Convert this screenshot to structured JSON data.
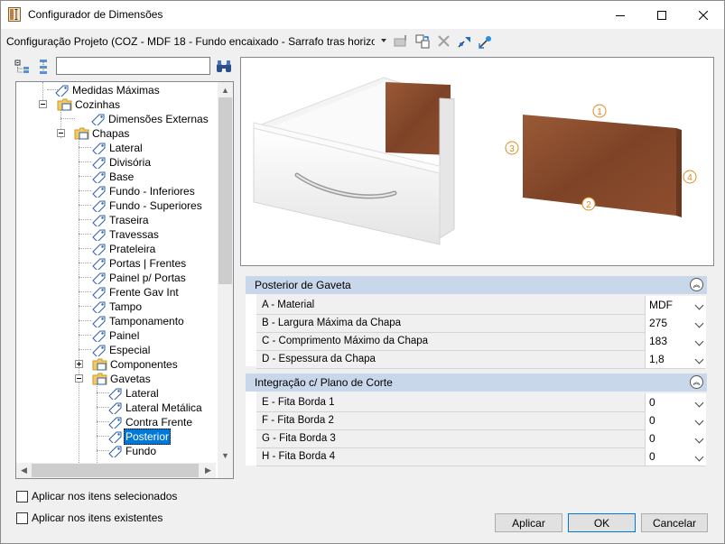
{
  "window": {
    "title": "Configurador de Dimensões",
    "minimize_icon": "minimize-icon",
    "maximize_icon": "maximize-icon",
    "close_icon": "close-icon"
  },
  "toolbar": {
    "config_selected": "Configuração Projeto (COZ - MDF 18 - Fundo encaixado - Sarrafo tras horizo",
    "icons": [
      "edit-config-icon",
      "copy-config-icon",
      "delete-icon",
      "export-icon",
      "import-icon"
    ]
  },
  "tree_toolbar": {
    "search_value": "",
    "search_placeholder": ""
  },
  "tree": {
    "nodes": [
      {
        "label": "Medidas Máximas",
        "icon": "tag-icon"
      },
      {
        "label": "Cozinhas",
        "icon": "folder-icon"
      },
      {
        "label": "Dimensões Externas",
        "icon": "tag-icon"
      },
      {
        "label": "Chapas",
        "icon": "folder-icon"
      },
      {
        "label": "Lateral",
        "icon": "tag-icon"
      },
      {
        "label": "Divisória",
        "icon": "tag-icon"
      },
      {
        "label": "Base",
        "icon": "tag-icon"
      },
      {
        "label": "Fundo - Inferiores",
        "icon": "tag-icon"
      },
      {
        "label": "Fundo - Superiores",
        "icon": "tag-icon"
      },
      {
        "label": "Traseira",
        "icon": "tag-icon"
      },
      {
        "label": "Travessas",
        "icon": "tag-icon"
      },
      {
        "label": "Prateleira",
        "icon": "tag-icon"
      },
      {
        "label": "Portas | Frentes",
        "icon": "tag-icon"
      },
      {
        "label": "Painel p/ Portas",
        "icon": "tag-icon"
      },
      {
        "label": "Frente Gav Int",
        "icon": "tag-icon"
      },
      {
        "label": "Tampo",
        "icon": "tag-icon"
      },
      {
        "label": "Tamponamento",
        "icon": "tag-icon"
      },
      {
        "label": "Painel",
        "icon": "tag-icon"
      },
      {
        "label": "Especial",
        "icon": "tag-icon"
      },
      {
        "label": "Componentes",
        "icon": "folder-icon"
      },
      {
        "label": "Gavetas",
        "icon": "folder-icon"
      },
      {
        "label": "Lateral",
        "icon": "tag-icon"
      },
      {
        "label": "Lateral Metálica",
        "icon": "tag-icon"
      },
      {
        "label": "Contra Frente",
        "icon": "tag-icon"
      },
      {
        "label": "Posterior",
        "icon": "tag-icon",
        "selected": true
      },
      {
        "label": "Fundo",
        "icon": "tag-icon"
      }
    ]
  },
  "preview": {
    "markers": [
      "1",
      "2",
      "3",
      "4"
    ]
  },
  "sections": [
    {
      "title": "Posterior de Gaveta",
      "rows": [
        {
          "label": "A - Material",
          "value": "MDF"
        },
        {
          "label": "B - Largura Máxima da Chapa",
          "value": "275"
        },
        {
          "label": "C - Comprimento Máximo da Chapa",
          "value": "183"
        },
        {
          "label": "D - Espessura da Chapa",
          "value": "1,8"
        }
      ]
    },
    {
      "title": "Integração c/ Plano de Corte",
      "rows": [
        {
          "label": "E - Fita Borda 1",
          "value": "0"
        },
        {
          "label": "F - Fita Borda 2",
          "value": "0"
        },
        {
          "label": "G - Fita Borda 3",
          "value": "0"
        },
        {
          "label": "H - Fita Borda 4",
          "value": "0"
        }
      ]
    }
  ],
  "options": {
    "apply_selected": "Aplicar nos itens selecionados",
    "apply_existing": "Aplicar nos itens existentes"
  },
  "buttons": {
    "apply": "Aplicar",
    "ok": "OK",
    "cancel": "Cancelar"
  },
  "colors": {
    "section_header": "#c8d7ea",
    "selection": "#0078d7",
    "wood": "#8b4a2b"
  }
}
